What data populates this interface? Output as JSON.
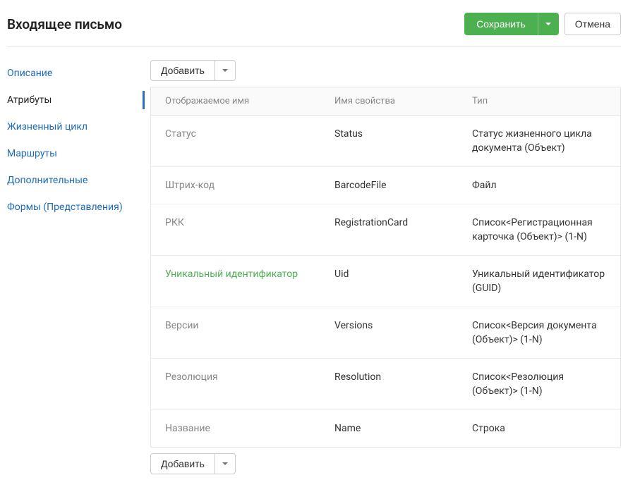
{
  "header": {
    "title": "Входящее письмо",
    "save_label": "Сохранить",
    "cancel_label": "Отмена"
  },
  "sidebar": {
    "items": [
      {
        "label": "Описание",
        "active": false,
        "slug": "description"
      },
      {
        "label": "Атрибуты",
        "active": true,
        "slug": "attributes"
      },
      {
        "label": "Жизненный цикл",
        "active": false,
        "slug": "lifecycle"
      },
      {
        "label": "Маршруты",
        "active": false,
        "slug": "routes"
      },
      {
        "label": "Дополнительные",
        "active": false,
        "slug": "additional"
      },
      {
        "label": "Формы (Представления)",
        "active": false,
        "slug": "forms"
      }
    ]
  },
  "toolbar": {
    "add_label": "Добавить"
  },
  "table": {
    "columns": {
      "display": "Отображаемое имя",
      "prop": "Имя свойства",
      "type": "Тип"
    },
    "rows": [
      {
        "display": "Статус",
        "prop": "Status",
        "type": "Статус жизненного цикла документа (Объект)",
        "highlight": false
      },
      {
        "display": "Штрих-код",
        "prop": "BarcodeFile",
        "type": "Файл",
        "highlight": false
      },
      {
        "display": "РКК",
        "prop": "RegistrationCard",
        "type": "Список<Регистрационная карточка (Объект)> (1-N)",
        "highlight": false
      },
      {
        "display": "Уникальный идентификатор",
        "prop": "Uid",
        "type": "Уникальный идентификатор (GUID)",
        "highlight": true
      },
      {
        "display": "Версии",
        "prop": "Versions",
        "type": "Список<Версия документа (Объект)> (1-N)",
        "highlight": false
      },
      {
        "display": "Резолюция",
        "prop": "Resolution",
        "type": "Список<Резолюция (Объект)> (1-N)",
        "highlight": false
      },
      {
        "display": "Название",
        "prop": "Name",
        "type": "Строка",
        "highlight": false
      }
    ]
  }
}
